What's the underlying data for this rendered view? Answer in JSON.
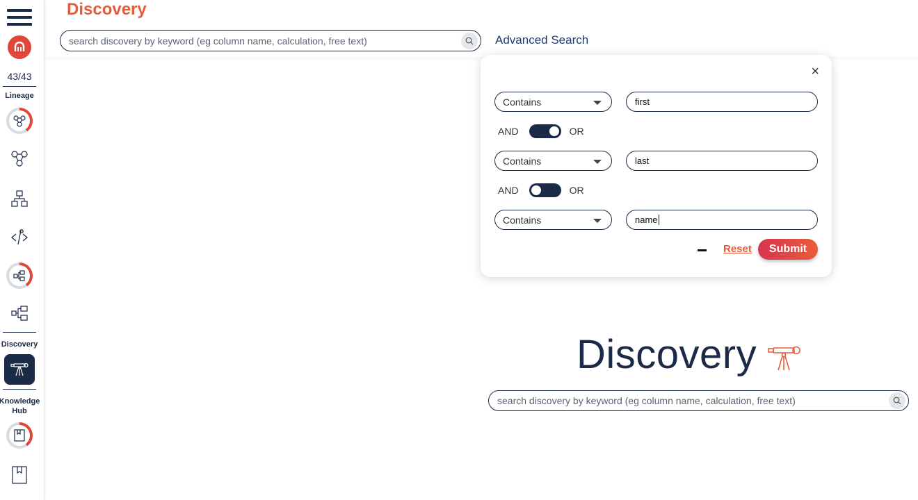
{
  "app": {
    "page_title": "Discovery"
  },
  "sidebar": {
    "menu_icon": "hamburger-menu-icon",
    "brand_icon": "brand-logo-icon",
    "count": "43/43",
    "sections": {
      "lineage": "Lineage",
      "discovery": "Discovery",
      "knowledge_hub": "Knowledge Hub"
    },
    "icons": [
      "lineage-ring-icon",
      "network-icon",
      "hierarchy-icon",
      "code-icon",
      "flow-ring-icon",
      "flow-icon",
      "telescope-icon",
      "book-ring-icon",
      "book-icon"
    ]
  },
  "header": {
    "search": {
      "placeholder": "search discovery by keyword (eg column name, calculation, free text)"
    },
    "advanced_search_label": "Advanced Search"
  },
  "advanced_search": {
    "close_label": "×",
    "conditions": [
      {
        "operator": "Contains",
        "value": "first"
      },
      {
        "operator": "Contains",
        "value": "last"
      },
      {
        "operator": "Contains",
        "value": "name"
      }
    ],
    "logic": [
      {
        "and_label": "AND",
        "or_label": "OR",
        "state": "OR"
      },
      {
        "and_label": "AND",
        "or_label": "OR",
        "state": "AND"
      }
    ],
    "reset_label": "Reset",
    "submit_label": "Submit"
  },
  "main": {
    "hero_title": "Discovery",
    "hero_icon": "telescope-icon",
    "search": {
      "placeholder": "search discovery by keyword (eg column name, calculation, free text)"
    }
  },
  "colors": {
    "accent": "#e35d3c",
    "navy": "#1b2a47",
    "submit_gradient_start": "#d7344f",
    "submit_gradient_end": "#ec5b3b"
  }
}
